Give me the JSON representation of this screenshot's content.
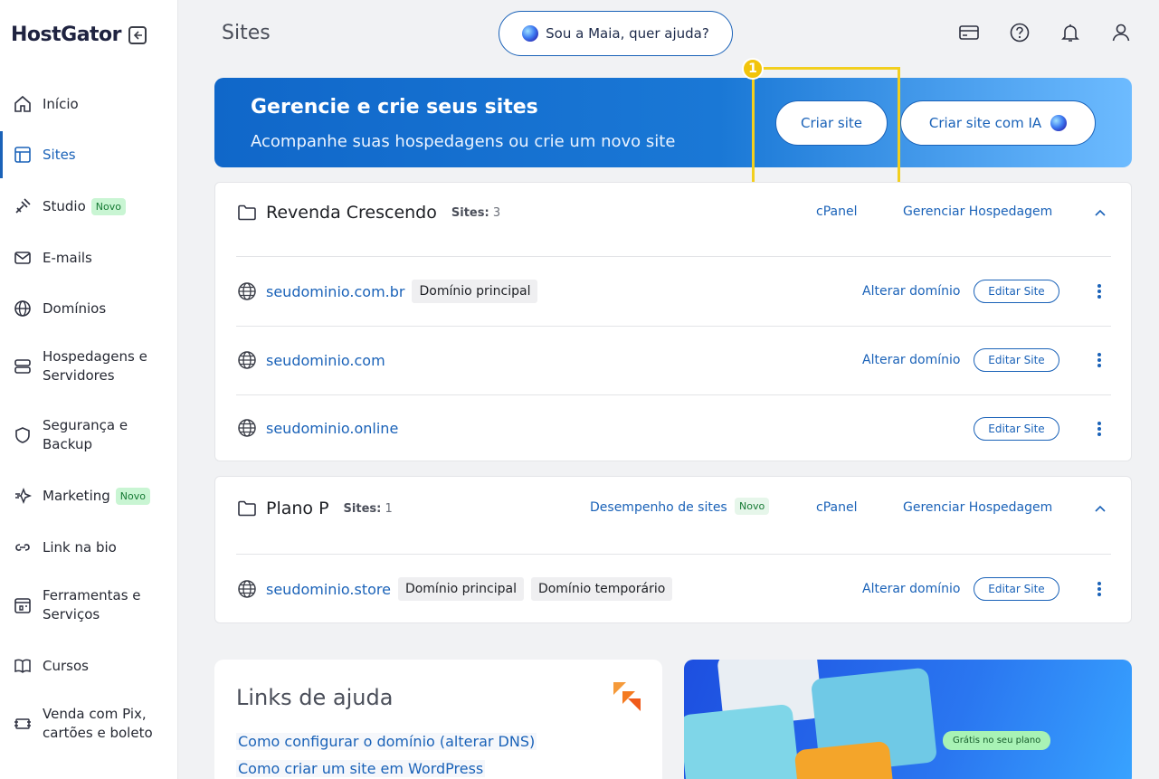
{
  "sidebar": {
    "logo": "HostGator",
    "items": [
      {
        "label": "Início",
        "icon": "home-icon"
      },
      {
        "label": "Sites",
        "icon": "layout-icon"
      },
      {
        "label": "Studio",
        "icon": "studio-icon",
        "badge": "Novo"
      },
      {
        "label": "E-mails",
        "icon": "mail-icon"
      },
      {
        "label": "Domínios",
        "icon": "globe-icon"
      },
      {
        "label": "Hospedagens e Servidores",
        "icon": "server-icon"
      },
      {
        "label": "Segurança e Backup",
        "icon": "shield-icon"
      },
      {
        "label": "Marketing",
        "icon": "marketing-icon",
        "badge": "Novo"
      },
      {
        "label": "Link na bio",
        "icon": "link-icon"
      },
      {
        "label": "Ferramentas e Serviços",
        "icon": "tools-icon"
      },
      {
        "label": "Cursos",
        "icon": "book-icon"
      },
      {
        "label": "Venda com Pix, cartões e boleto",
        "icon": "payment-icon"
      }
    ]
  },
  "header": {
    "title": "Sites",
    "maia_label": "Sou a Maia, quer ajuda?"
  },
  "banner": {
    "title": "Gerencie e crie seus sites",
    "subtitle": "Acompanhe suas hospedagens ou crie um novo site",
    "create_label": "Criar site",
    "create_ai_label": "Criar site com IA",
    "step": "1"
  },
  "groups": [
    {
      "name": "Revenda Crescendo",
      "sites_label": "Sites:",
      "sites_count": "3",
      "cpanel": "cPanel",
      "manage": "Gerenciar Hospedagem",
      "sites": [
        {
          "domain": "seudominio.com.br",
          "tags": [
            "Domínio principal"
          ],
          "change": "Alterar domínio",
          "edit": "Editar Site"
        },
        {
          "domain": "seudominio.com",
          "tags": [],
          "change": "Alterar domínio",
          "edit": "Editar Site"
        },
        {
          "domain": "seudominio.online",
          "tags": [],
          "change": "",
          "edit": "Editar Site"
        }
      ]
    },
    {
      "name": "Plano P",
      "sites_label": "Sites:",
      "sites_count": "1",
      "performance": "Desempenho de sites",
      "performance_badge": "Novo",
      "cpanel": "cPanel",
      "manage": "Gerenciar Hospedagem",
      "sites": [
        {
          "domain": "seudominio.store",
          "tags": [
            "Domínio principal",
            "Domínio temporário"
          ],
          "change": "Alterar domínio",
          "edit": "Editar Site"
        }
      ]
    }
  ],
  "help": {
    "title": "Links de ajuda",
    "links": [
      "Como configurar o domínio (alterar DNS)",
      "Como criar um site em WordPress"
    ]
  },
  "promo": {
    "badge": "Grátis no seu plano"
  },
  "colors": {
    "accent": "#1a62b8",
    "highlight": "#f2cf1e",
    "badge_green": "#c9f5d3"
  }
}
